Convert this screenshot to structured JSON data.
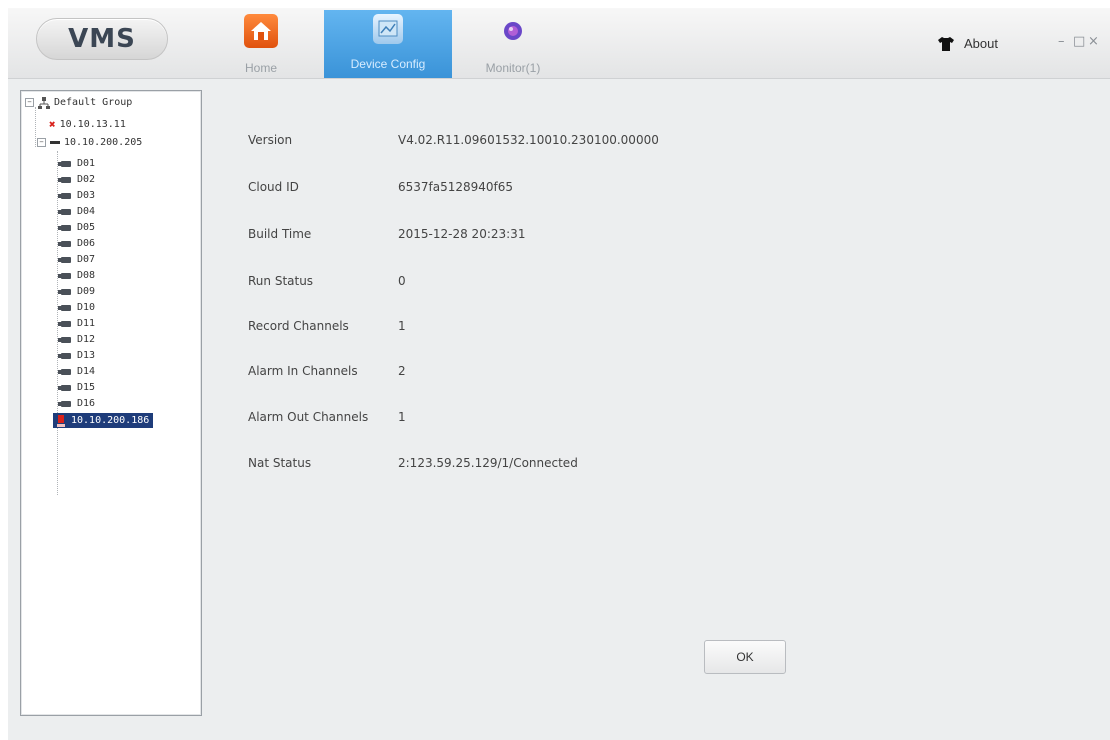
{
  "app": {
    "logo": "VMS",
    "tabs": [
      {
        "label": "Home",
        "icon": "home-icon",
        "active": false
      },
      {
        "label": "Device Config",
        "icon": "device-config-icon",
        "active": true
      },
      {
        "label": "Monitor(1)",
        "icon": "monitor-icon",
        "active": false
      }
    ],
    "about_label": "About",
    "window_controls": {
      "minimize": "–",
      "maximize": "□",
      "close": "×"
    },
    "colors": {
      "accent": "#3a93d8",
      "selected": "#1e3c7a",
      "error": "#d9221c"
    }
  },
  "tree": {
    "root": "Default Group",
    "devices": [
      {
        "label": "10.10.13.11",
        "status": "offline"
      },
      {
        "label": "10.10.200.205",
        "status": "online",
        "channels": [
          "D01",
          "D02",
          "D03",
          "D04",
          "D05",
          "D06",
          "D07",
          "D08",
          "D09",
          "D10",
          "D11",
          "D12",
          "D13",
          "D14",
          "D15",
          "D16"
        ]
      },
      {
        "label": "10.10.200.186",
        "status": "selected"
      }
    ]
  },
  "info": [
    {
      "label": "Version",
      "value": "V4.02.R11.09601532.10010.230100.00000"
    },
    {
      "label": "Cloud ID",
      "value": "6537fa5128940f65"
    },
    {
      "label": "Build Time",
      "value": "2015-12-28 20:23:31"
    },
    {
      "label": "Run Status",
      "value": "0"
    },
    {
      "label": "Record Channels",
      "value": "1"
    },
    {
      "label": "Alarm In Channels",
      "value": "2"
    },
    {
      "label": "Alarm Out Channels",
      "value": "1"
    },
    {
      "label": "Nat Status",
      "value": "2:123.59.25.129/1/Connected"
    }
  ],
  "ok_label": "OK"
}
